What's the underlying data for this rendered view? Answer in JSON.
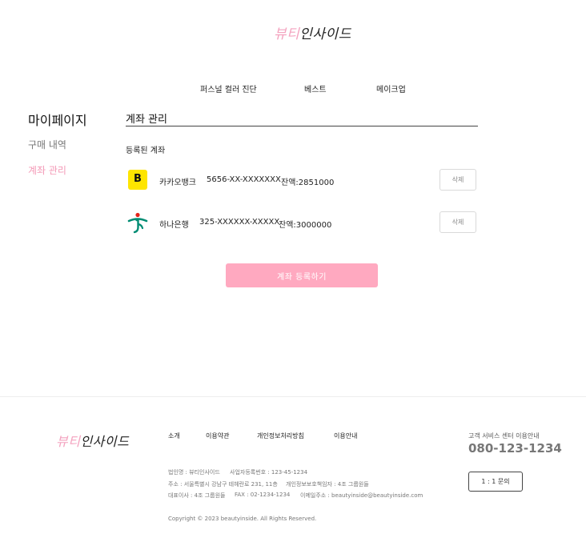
{
  "header": {
    "logo_pink": "뷰티",
    "logo_dark": "인사이드"
  },
  "nav": {
    "items": [
      "퍼스널 컬러 진단",
      "베스트",
      "메이크업"
    ]
  },
  "sidebar": {
    "title": "마이페이지",
    "items": [
      {
        "label": "구매 내역",
        "active": false
      },
      {
        "label": "계좌 관리",
        "active": true
      }
    ]
  },
  "main": {
    "section_title": "계좌 관리",
    "registered_label": "등록된 계좌",
    "accounts": [
      {
        "bank": "카카오뱅크",
        "number": "5656-XX-XXXXXXX",
        "balance": "잔액:2851000",
        "delete_label": "삭제",
        "icon": "kakaobank-icon",
        "logo_text": "B"
      },
      {
        "bank": "하나은행",
        "number": "325-XXXXXX-XXXXX",
        "balance": "잔액:3000000",
        "delete_label": "삭제",
        "icon": "hanabank-icon"
      }
    ],
    "register_button": "계좌 등록하기"
  },
  "footer": {
    "logo_pink": "뷰티",
    "logo_dark": "인사이드",
    "links": [
      "소개",
      "이용약관",
      "개인정보처리방침",
      "이용안내"
    ],
    "info": {
      "company": "법인명 : 뷰티인사이드",
      "business_no": "사업자등록번호 : 123-45-1234",
      "address": "주소 : 서울특별시 강남구 테헤란로 231, 11층",
      "privacy_officer": "개인정보보호책임자 : 4조 그룹원들",
      "ceo": "대표이사 : 4조 그룹원들",
      "fax": "FAX : 02-1234-1234",
      "email": "이메일주소 : beautyinside@beautyinside.com"
    },
    "copyright": "Copyright © 2023 beautyinside. All Rights Reserved.",
    "cs_label": "고객 서비스 센터 이용안내",
    "cs_phone": "080-123-1234",
    "inquiry_button": "1 : 1 문의"
  },
  "colors": {
    "brand_pink": "#f4a3bf",
    "button_pink": "#ffa9c0",
    "kakao_yellow": "#fee500",
    "hana_green": "#008c73",
    "hana_red": "#e2231a"
  }
}
